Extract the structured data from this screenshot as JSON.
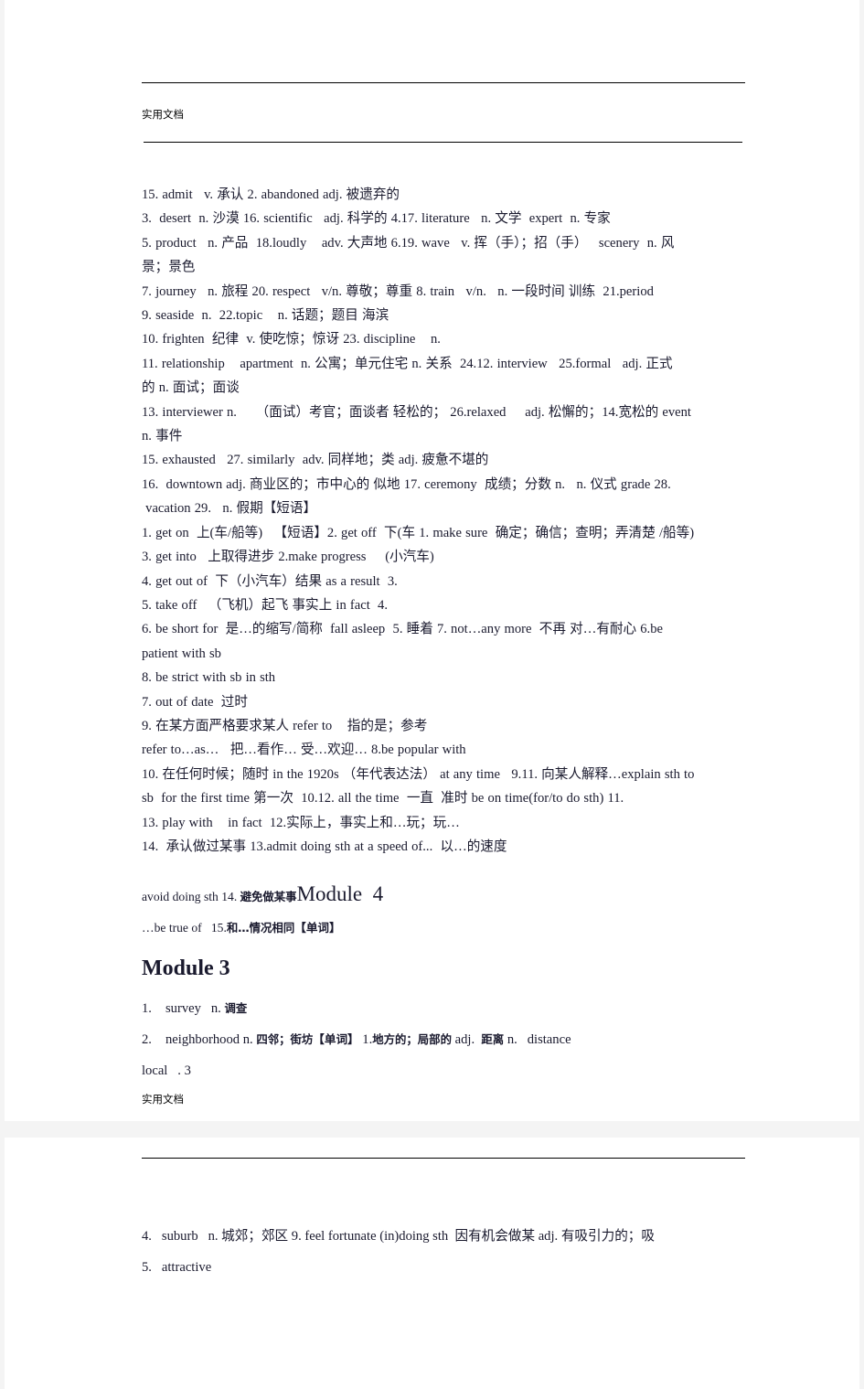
{
  "document": {
    "watermark": "实用文档",
    "page1": {
      "lines": [
        "15. admit   v. 承认 2. abandoned adj. 被遗弃的",
        "3.  desert  n. 沙漠 16. scientific   adj. 科学的 4.17. literature   n. 文学  expert  n. 专家",
        "5. product   n. 产品  18.loudly    adv. 大声地 6.19. wave   v. 挥（手）；招（手）   scenery  n. 风",
        "景；景色",
        "7. journey   n. 旅程 20. respect   v/n. 尊敬；尊重 8. train   v/n.   n. 一段时间 训练  21.period",
        "9. seaside  n.  22.topic    n. 话题；题目 海滨",
        "10. frighten  纪律  v. 使吃惊；惊讶 23. discipline    n.",
        "11. relationship    apartment  n. 公寓；单元住宅 n. 关系  24.12. interview   25.formal   adj. 正式",
        "的 n. 面试；面谈",
        "13. interviewer n.     （面试）考官；面谈者 轻松的； 26.relaxed     adj. 松懈的；14.宽松的 event",
        "n. 事件",
        "15. exhausted   27. similarly  adv. 同样地；类 adj. 疲惫不堪的",
        "16.  downtown adj. 商业区的；市中心的 似地 17. ceremony  成绩；分数 n.   n. 仪式 grade 28.",
        " vacation 29.   n. 假期【短语】",
        "1. get on  上(车/船等)   【短语】2. get off  下(车 1. make sure  确定；确信；查明；弄清楚 /船等)",
        "3. get into   上取得进步 2.make progress     (小汽车)",
        "4. get out of  下（小汽车）结果 as a result  3.",
        "5. take off   （飞机）起飞 事实上 in fact  4.",
        "6. be short for  是…的缩写/简称  fall asleep  5. 睡着 7. not…any more  不再 对…有耐心 6.be",
        "patient with sb",
        "8. be strict with sb in sth",
        "7. out of date  过时",
        "9. 在某方面严格要求某人 refer to    指的是；参考",
        "refer to…as…   把…看作… 受…欢迎… 8.be popular with",
        "10. 在任何时候；随时 in the 1920s （年代表达法） at any time   9.11. 向某人解释…explain sth to",
        "sb  for the first time 第一次  10.12. all the time  一直  准时 be on time(for/to do sth) 11.",
        "13. play with    in fact  12.实际上，事实上和…玩；玩…",
        "14.  承认做过某事 13.admit doing sth at a speed of...  以…的速度"
      ],
      "module4_line": {
        "prefix": "avoid doing sth 14. ",
        "cjk": "避免做某事",
        "module": "Module  4"
      },
      "betrueof_line": {
        "prefix": "…be true of   15.",
        "cjk": "和…情况相同",
        "bracket": "【单词】"
      },
      "module3_heading": "Module  3",
      "module3_items": [
        {
          "num": "1.",
          "text": "survey   n. ",
          "cjk": "调查"
        },
        {
          "num": "2.",
          "text": "neighborhood n. ",
          "cjk": "四邻；街坊",
          "bracket": "【单词】",
          "tail": " 1.",
          "cjk2": "地方的；局部的",
          "tail2": " adj.  ",
          "cjk3": "距离",
          "tail3": " n.   distance"
        },
        {
          "num": "",
          "text": "local   . 3",
          "cjk": ""
        }
      ]
    },
    "page2": {
      "lines": [
        "4.   suburb   n. 城郊；郊区 9. feel fortunate (in)doing sth  因有机会做某 adj. 有吸引力的；吸",
        "5.   attractive"
      ]
    }
  }
}
